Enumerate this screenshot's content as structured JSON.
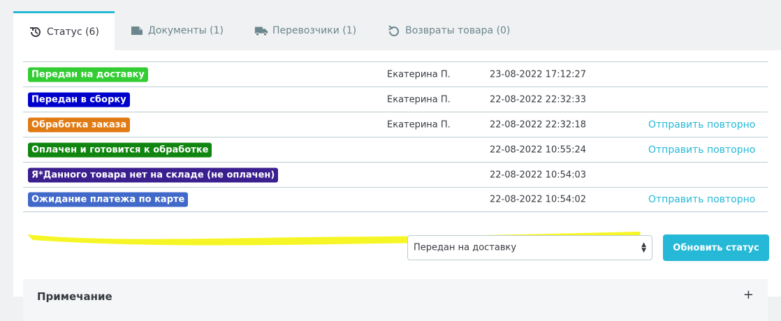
{
  "tabs": [
    {
      "label": "Статус (6)",
      "icon": "history-icon",
      "active": true
    },
    {
      "label": "Документы (1)",
      "icon": "document-icon",
      "active": false
    },
    {
      "label": "Перевозчики (1)",
      "icon": "truck-icon",
      "active": false
    },
    {
      "label": "Возвраты товара (0)",
      "icon": "undo-icon",
      "active": false
    }
  ],
  "history": [
    {
      "status": "Передан на доставку",
      "color": "#32cd32",
      "employee": "Екатерина П.",
      "date": "23-08-2022 17:12:27",
      "action": ""
    },
    {
      "status": "Передан в сборку",
      "color": "#0000cd",
      "employee": "Екатерина П.",
      "date": "22-08-2022 22:32:33",
      "action": ""
    },
    {
      "status": "Обработка заказа",
      "color": "#e07b14",
      "employee": "Екатерина П.",
      "date": "22-08-2022 22:32:18",
      "action": "Отправить повторно"
    },
    {
      "status": "Оплачен и готовится к обработке",
      "color": "#108510",
      "employee": "",
      "date": "22-08-2022 10:55:24",
      "action": "Отправить повторно"
    },
    {
      "status": "Я*Данного товара нет на складе (не оплачен)",
      "color": "#3b1f8f",
      "employee": "",
      "date": "22-08-2022 10:54:03",
      "action": ""
    },
    {
      "status": "Ожидание платежа по карте",
      "color": "#4169c9",
      "employee": "",
      "date": "22-08-2022 10:54:02",
      "action": "Отправить повторно"
    }
  ],
  "status_select": {
    "value": "Передан на доставку"
  },
  "update_button": {
    "label": "Обновить статус"
  },
  "note": {
    "title": "Примечание",
    "toggle": "+"
  },
  "colors": {
    "accent": "#25b9d7",
    "highlight": "#f4f400"
  }
}
